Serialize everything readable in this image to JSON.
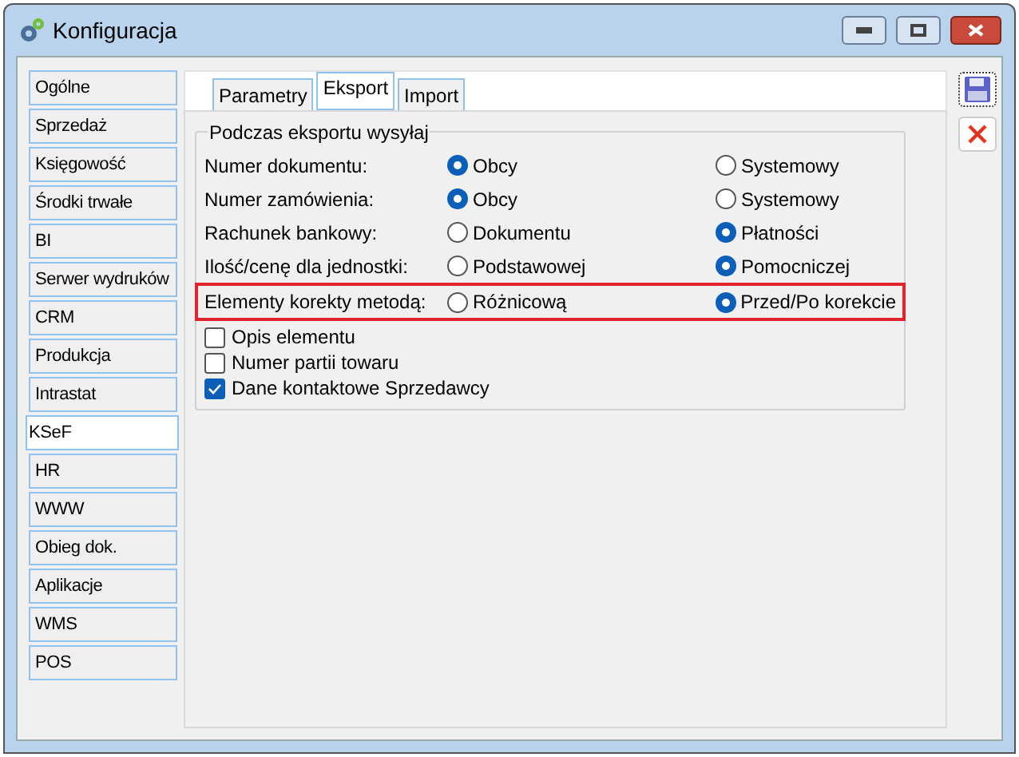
{
  "window": {
    "title": "Konfiguracja"
  },
  "sidebar": {
    "items": [
      {
        "label": "Ogólne",
        "selected": false
      },
      {
        "label": "Sprzedaż",
        "selected": false
      },
      {
        "label": "Księgowość",
        "selected": false
      },
      {
        "label": "Środki trwałe",
        "selected": false
      },
      {
        "label": "BI",
        "selected": false
      },
      {
        "label": "Serwer wydruków",
        "selected": false
      },
      {
        "label": "CRM",
        "selected": false
      },
      {
        "label": "Produkcja",
        "selected": false
      },
      {
        "label": "Intrastat",
        "selected": false
      },
      {
        "label": "KSeF",
        "selected": true
      },
      {
        "label": "HR",
        "selected": false
      },
      {
        "label": "WWW",
        "selected": false
      },
      {
        "label": "Obieg dok.",
        "selected": false
      },
      {
        "label": "Aplikacje",
        "selected": false
      },
      {
        "label": "WMS",
        "selected": false
      },
      {
        "label": "POS",
        "selected": false
      }
    ]
  },
  "tabs": [
    {
      "label": "Parametry",
      "selected": false
    },
    {
      "label": "Eksport",
      "selected": true
    },
    {
      "label": "Import",
      "selected": false
    }
  ],
  "group": {
    "title": "Podczas eksportu wysyłaj",
    "rows": [
      {
        "label": "Numer dokumentu:",
        "highlighted": false,
        "options": [
          {
            "label": "Obcy",
            "selected": true
          },
          {
            "label": "Systemowy",
            "selected": false
          }
        ]
      },
      {
        "label": "Numer zamówienia:",
        "highlighted": false,
        "options": [
          {
            "label": "Obcy",
            "selected": true
          },
          {
            "label": "Systemowy",
            "selected": false
          }
        ]
      },
      {
        "label": "Rachunek bankowy:",
        "highlighted": false,
        "options": [
          {
            "label": "Dokumentu",
            "selected": false
          },
          {
            "label": "Płatności",
            "selected": true
          }
        ]
      },
      {
        "label": "Ilość/cenę dla jednostki:",
        "highlighted": false,
        "options": [
          {
            "label": "Podstawowej",
            "selected": false
          },
          {
            "label": "Pomocniczej",
            "selected": true
          }
        ]
      },
      {
        "label": "Elementy korekty metodą:",
        "highlighted": true,
        "options": [
          {
            "label": "Różnicową",
            "selected": false
          },
          {
            "label": "Przed/Po korekcie",
            "selected": true
          }
        ]
      }
    ],
    "checkboxes": [
      {
        "label": "Opis elementu",
        "checked": false
      },
      {
        "label": "Numer partii towaru",
        "checked": false
      },
      {
        "label": "Dane kontaktowe Sprzedawcy",
        "checked": true
      }
    ]
  }
}
